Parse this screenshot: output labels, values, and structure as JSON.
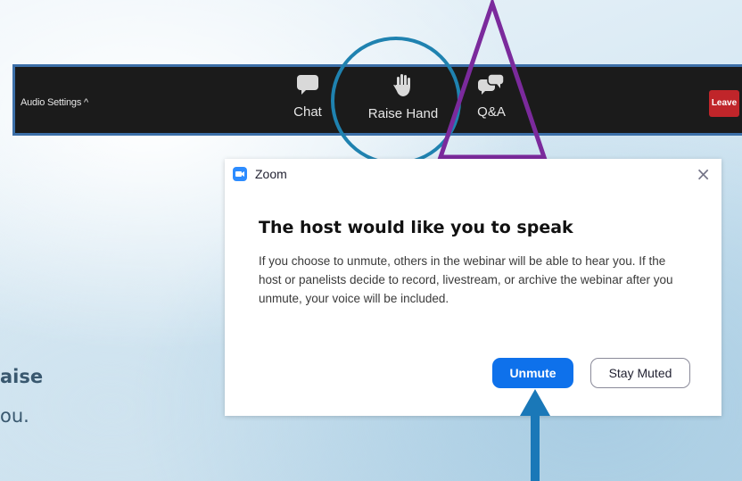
{
  "toolbar": {
    "audio_settings": "Audio Settings ^",
    "chat": "Chat",
    "raise_hand": "Raise Hand",
    "qa": "Q&A",
    "leave": "Leave"
  },
  "dialog": {
    "app_name": "Zoom",
    "close": "×",
    "title": "The host would like you to speak",
    "body": "If you choose to unmute, others in the webinar will be able to hear you. If the host or panelists decide to record, livestream, or archive the webinar after you unmute, your voice will be included.",
    "unmute": "Unmute",
    "stay_muted": "Stay Muted"
  },
  "background_text": {
    "line1": "aise",
    "line2": "ou."
  },
  "colors": {
    "toolbar_bg": "#1b1b1b",
    "toolbar_border": "#3c6fa8",
    "circle": "#1f82b0",
    "triangle": "#7b2a9c",
    "arrow": "#1a78b8",
    "unmute": "#0e71eb",
    "leave": "#c0252a"
  },
  "icons": [
    "chat-bubble-icon",
    "raised-hand-icon",
    "qa-bubbles-icon",
    "zoom-camera-icon",
    "close-icon"
  ]
}
